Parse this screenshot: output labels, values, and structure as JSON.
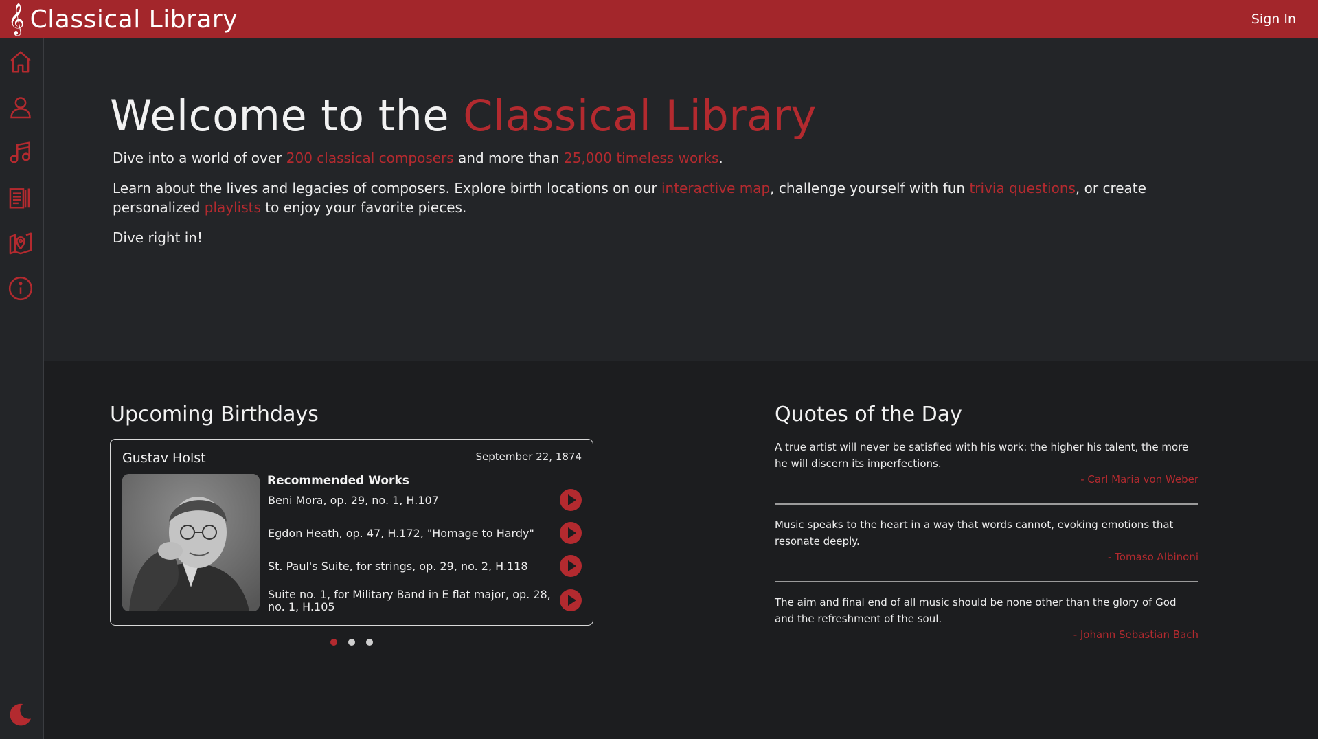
{
  "app": {
    "title": "Classical Library",
    "clef_glyph": "𝄞",
    "accent": "#b32a2f"
  },
  "header": {
    "sign_in": "Sign In"
  },
  "sidebar": {
    "items": [
      {
        "icon": "home-icon"
      },
      {
        "icon": "user-icon"
      },
      {
        "icon": "music-note-icon"
      },
      {
        "icon": "library-icon"
      },
      {
        "icon": "map-pin-icon"
      },
      {
        "icon": "info-icon"
      }
    ],
    "theme_toggle": "moon-icon"
  },
  "hero": {
    "title_prefix": "Welcome to the ",
    "title_accent": "Classical Library",
    "p1": {
      "a": "Dive into a world of over ",
      "link1": "200 classical composers",
      "b": " and more than ",
      "link2": "25,000 timeless works",
      "c": "."
    },
    "p2": {
      "a": "Learn about the lives and legacies of composers. Explore birth locations on our ",
      "link1": "interactive map",
      "b": ", challenge yourself with fun ",
      "link2": "trivia questions",
      "c": ", or create personalized ",
      "link3": "playlists",
      "d": " to enjoy your favorite pieces."
    },
    "p3": "Dive right in!"
  },
  "birthdays": {
    "heading": "Upcoming Birthdays",
    "composer": "Gustav Holst",
    "date": "September 22, 1874",
    "recommended_heading": "Recommended Works",
    "works": [
      "Beni Mora, op. 29, no. 1, H.107",
      "Egdon Heath, op. 47, H.172, \"Homage to Hardy\"",
      "St. Paul's Suite, for strings, op. 29, no. 2, H.118",
      "Suite no. 1, for Military Band in E flat major, op. 28, no. 1, H.105"
    ],
    "carousel_active": 0
  },
  "quotes": {
    "heading": "Quotes of the Day",
    "items": [
      {
        "text": "A true artist will never be satisfied with his work: the higher his talent, the more he will discern its imperfections.",
        "author": "- Carl Maria von Weber"
      },
      {
        "text": "Music speaks to the heart in a way that words cannot, evoking emotions that resonate deeply.",
        "author": "- Tomaso Albinoni"
      },
      {
        "text": "The aim and final end of all music should be none other than the glory of God and the refreshment of the soul.",
        "author": "- Johann Sebastian Bach"
      }
    ]
  }
}
